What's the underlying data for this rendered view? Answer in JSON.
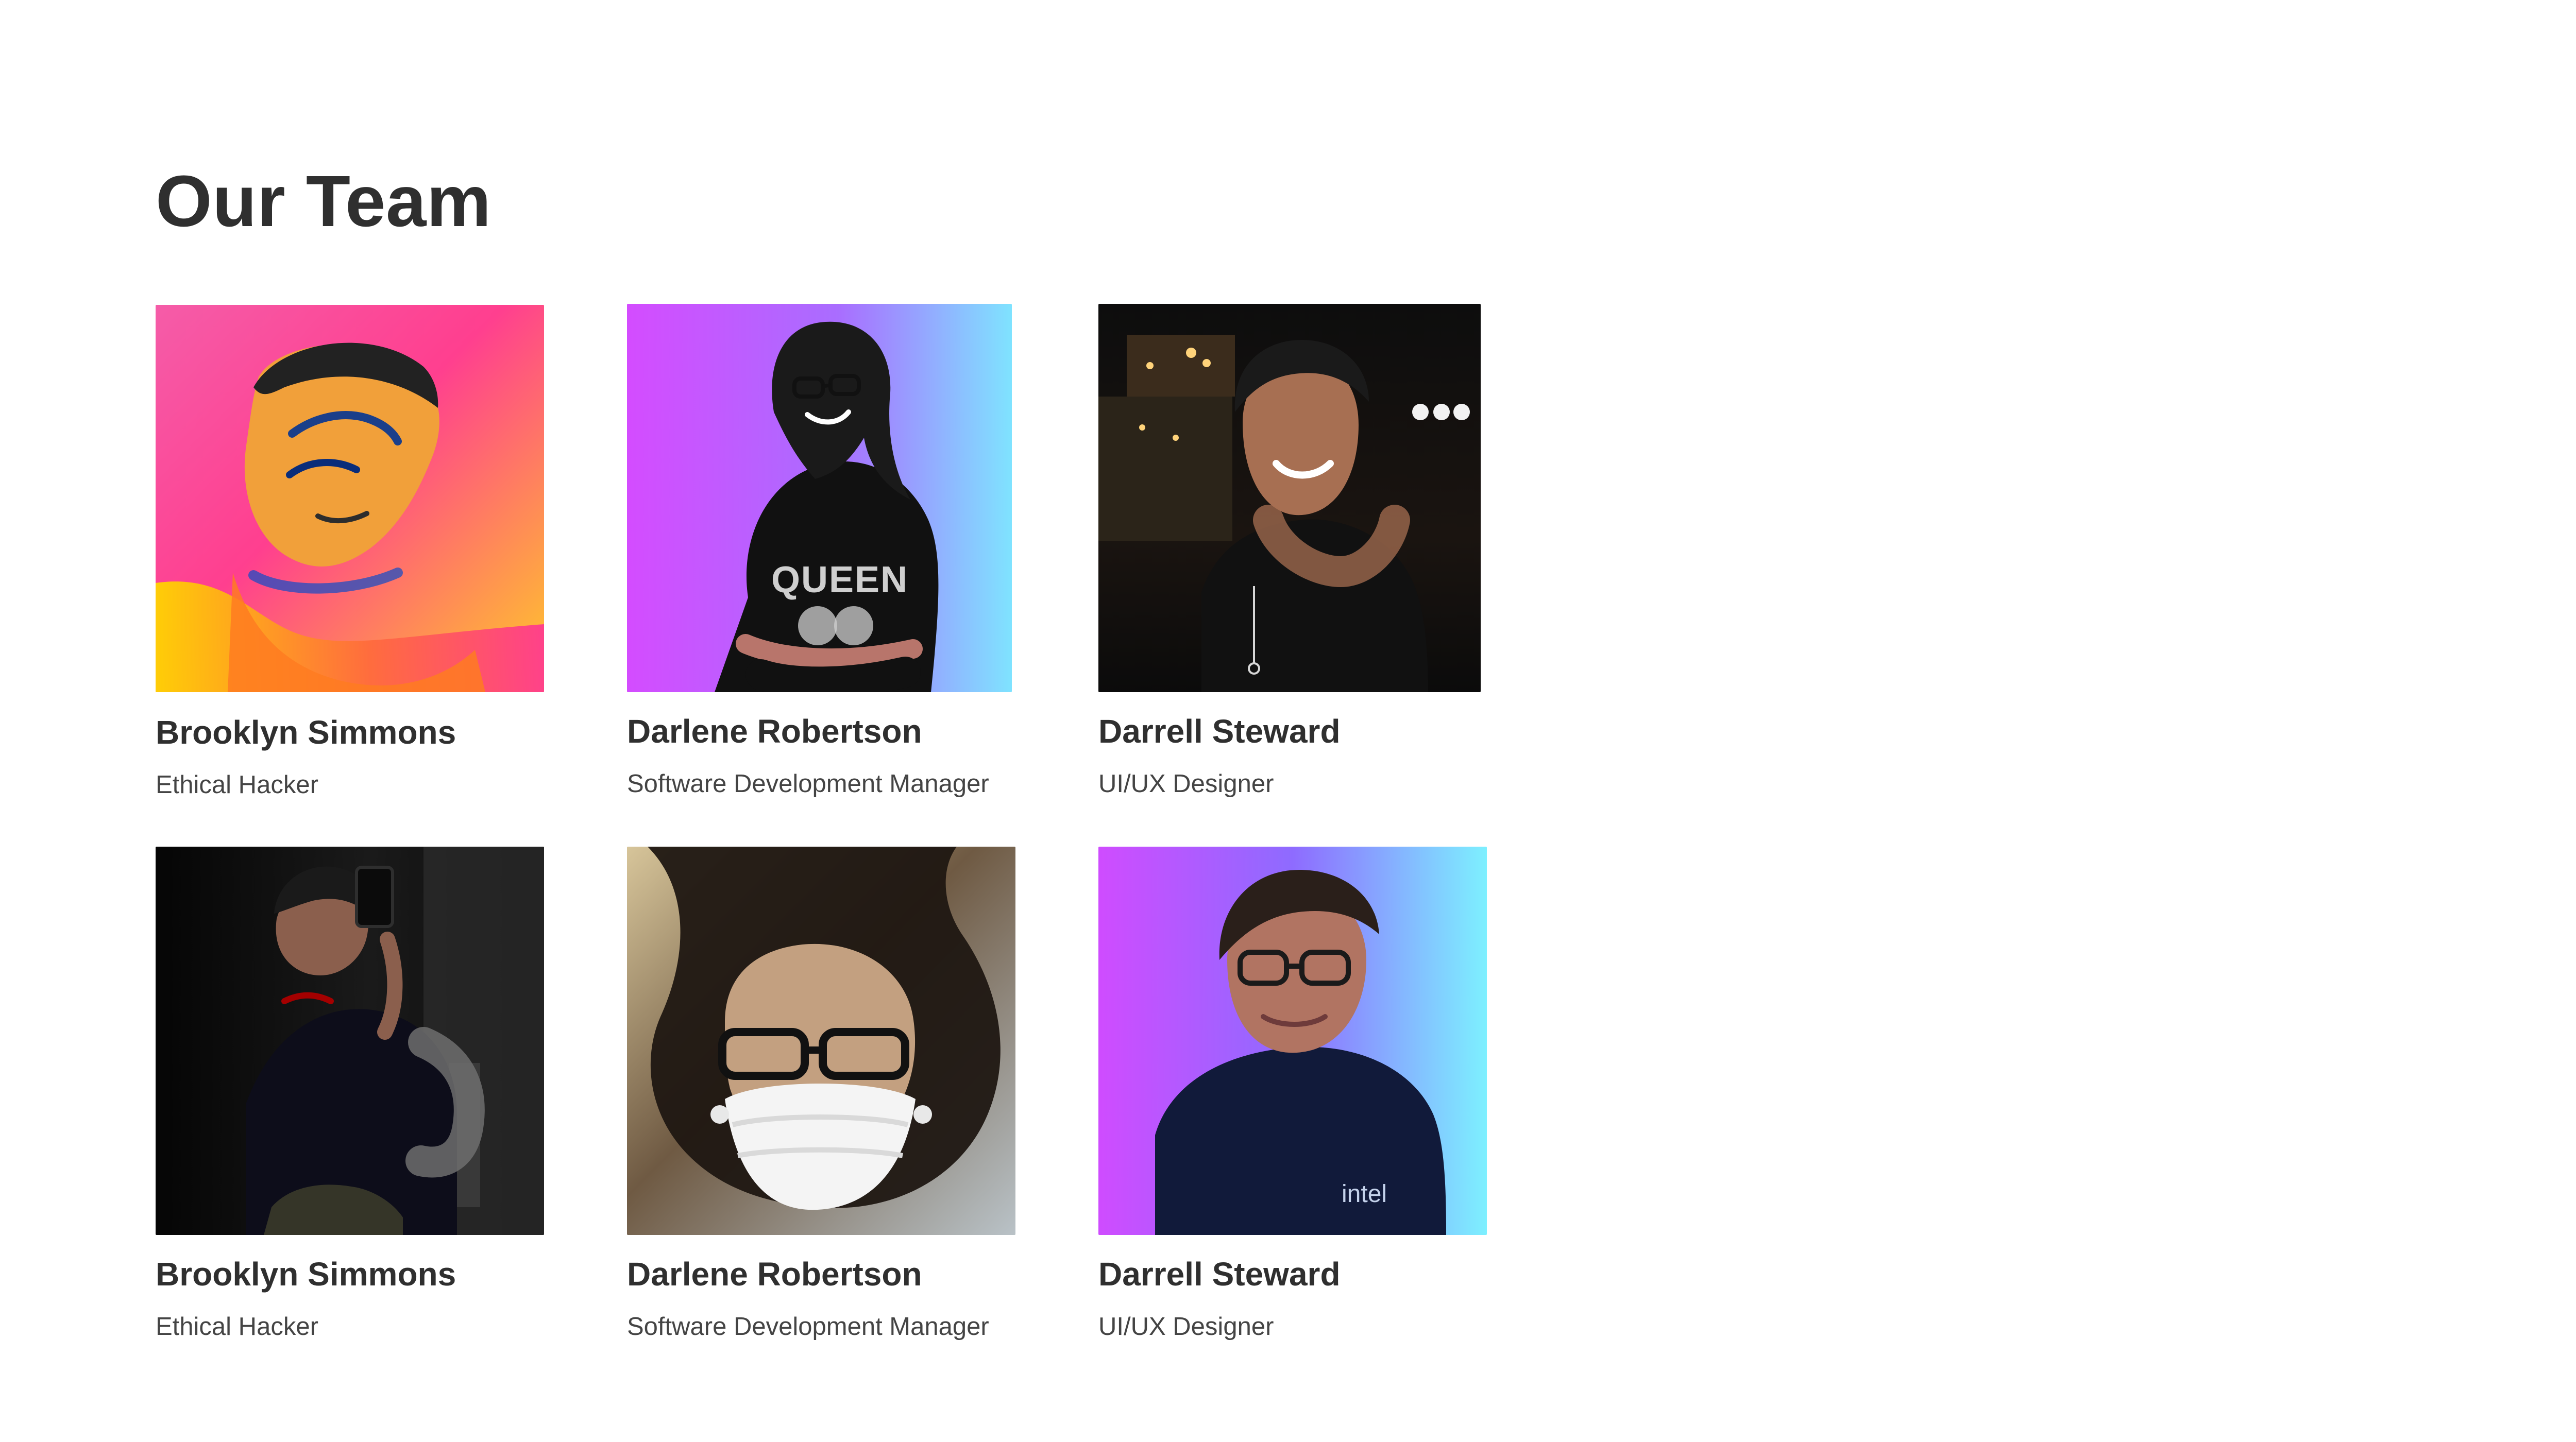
{
  "page": {
    "title": "Our Team"
  },
  "team": [
    {
      "name": "Brooklyn Simmons",
      "role": "Ethical Hacker",
      "photo": "avatar-portrait-illustration"
    },
    {
      "name": "Darlene Robertson",
      "role": "Software Development Manager",
      "photo": "avatar-woman-gradient"
    },
    {
      "name": "Darrell Steward",
      "role": "UI/UX Designer",
      "photo": "avatar-night-city"
    },
    {
      "name": "Brooklyn Simmons",
      "role": "Ethical Hacker",
      "photo": "avatar-mirror-selfie"
    },
    {
      "name": "Darlene Robertson",
      "role": "Software Development Manager",
      "photo": "avatar-curly-hair-mask"
    },
    {
      "name": "Darrell Steward",
      "role": "UI/UX Designer",
      "photo": "avatar-gradient-portrait"
    }
  ],
  "colors": {
    "text": "#2f2f2f",
    "subtext": "#444444",
    "background": "#ffffff"
  }
}
